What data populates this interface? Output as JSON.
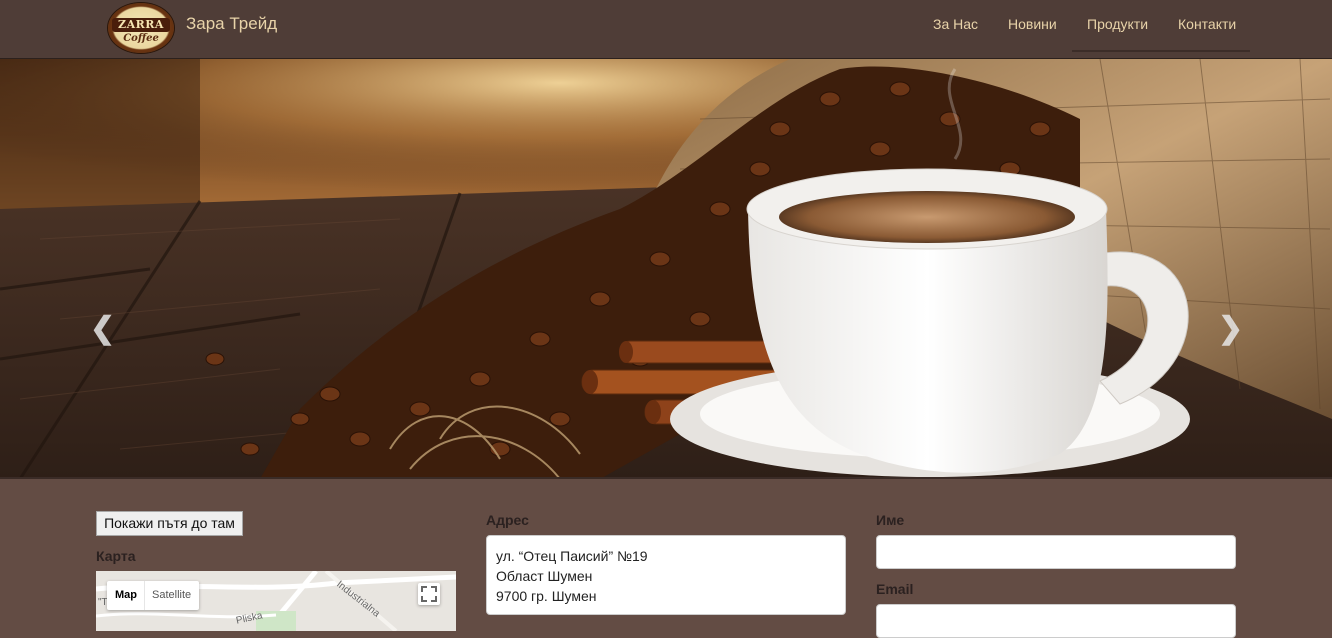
{
  "header": {
    "logo": {
      "top_text": "ZARRA",
      "bottom_text": "Coffee"
    },
    "brand": "Зара Трейд",
    "nav": [
      {
        "label": "За Нас"
      },
      {
        "label": "Новини"
      },
      {
        "label": "Продукти",
        "active": true
      },
      {
        "label": "Контакти"
      }
    ]
  },
  "carousel": {
    "prev_icon": "chevron-left-icon",
    "next_icon": "chevron-right-icon"
  },
  "map_section": {
    "route_button": "Покажи пътя до там",
    "label": "Карта",
    "map_type_map": "Map",
    "map_type_satellite": "Satellite",
    "street_labels": [
      "Industrialna",
      "Pliska",
      "\"T..."
    ]
  },
  "address_section": {
    "label": "Адрес",
    "lines": [
      "ул. “Отец Паисий” №19",
      "Област Шумен",
      "9700 гр. Шумен"
    ]
  },
  "contact_form": {
    "name_label": "Име",
    "name_value": "",
    "email_label": "Email",
    "email_value": ""
  },
  "colors": {
    "page_background": "#634c44",
    "navbar_background": "#4f3d37",
    "nav_text": "#e8d3a9"
  }
}
